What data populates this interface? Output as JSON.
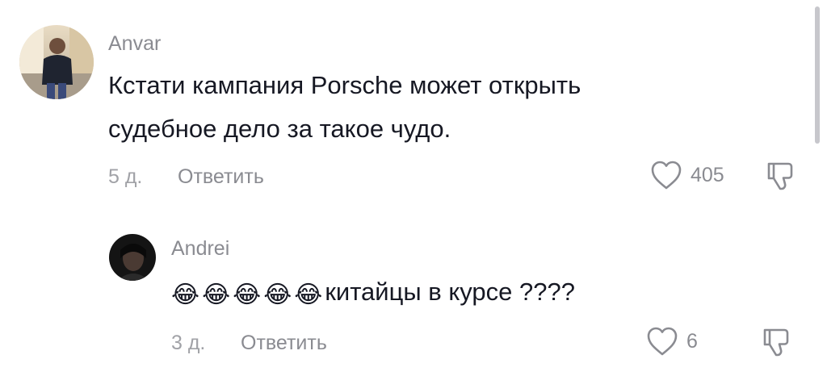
{
  "comments": [
    {
      "username": "Anvar",
      "text_line1": "Кстати кампания Porsche может открыть",
      "text_line2": "судебное дело за такое чудо.",
      "time": "5 д.",
      "reply_label": "Ответить",
      "likes": "405"
    },
    {
      "username": "Andrei",
      "emojis": [
        "😂",
        "😂",
        "😂",
        "😂",
        "😂"
      ],
      "text": "китайцы в курсе ????",
      "time": "3 д.",
      "reply_label": "Ответить",
      "likes": "6"
    }
  ],
  "colors": {
    "text": "#161823",
    "meta": "#8a8b91",
    "icon": "#8a8b91",
    "scrollbar": "#c7c7cc"
  },
  "icons": {
    "like": "heart-outline-icon",
    "dislike": "thumb-down-icon"
  }
}
